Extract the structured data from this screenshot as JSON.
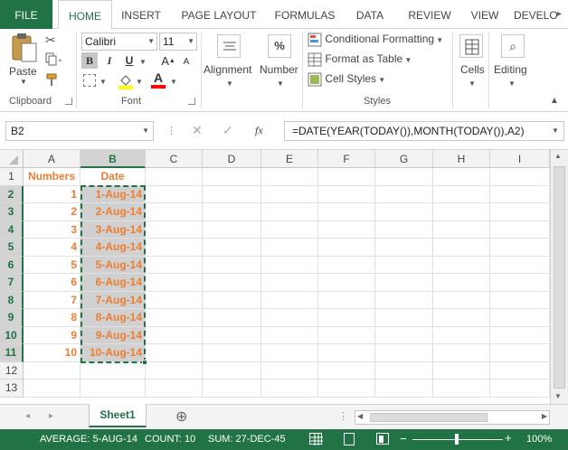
{
  "ribbon_tabs": [
    "FILE",
    "HOME",
    "INSERT",
    "PAGE LAYOUT",
    "FORMULAS",
    "DATA",
    "REVIEW",
    "VIEW",
    "DEVELO"
  ],
  "clipboard": {
    "paste_label": "Paste",
    "group_label": "Clipboard"
  },
  "font": {
    "name": "Calibri",
    "size": "11",
    "bold": "B",
    "italic": "I",
    "underline": "U",
    "grow": "A",
    "shrink": "A",
    "font_color": "A",
    "group_label": "Font"
  },
  "alignment": {
    "label": "Alignment"
  },
  "number": {
    "label": "Number",
    "symbol": "%"
  },
  "styles": {
    "conditional": "Conditional Formatting",
    "format_table": "Format as Table",
    "cell_styles": "Cell Styles",
    "group_label": "Styles"
  },
  "cells": {
    "label": "Cells"
  },
  "editing": {
    "label": "Editing"
  },
  "formula_bar": {
    "name_box": "B2",
    "fx": "fx",
    "formula": "=DATE(YEAR(TODAY()),MONTH(TODAY()),A2)"
  },
  "columns": [
    "A",
    "B",
    "C",
    "D",
    "E",
    "F",
    "G",
    "H",
    "I"
  ],
  "rows": [
    "1",
    "2",
    "3",
    "4",
    "5",
    "6",
    "7",
    "8",
    "9",
    "10",
    "11",
    "12",
    "13"
  ],
  "table": {
    "header_a": "Numbers",
    "header_b": "Date",
    "numbers": [
      "1",
      "2",
      "3",
      "4",
      "5",
      "6",
      "7",
      "8",
      "9",
      "10"
    ],
    "dates": [
      "1-Aug-14",
      "2-Aug-14",
      "3-Aug-14",
      "4-Aug-14",
      "5-Aug-14",
      "6-Aug-14",
      "7-Aug-14",
      "8-Aug-14",
      "9-Aug-14",
      "10-Aug-14"
    ]
  },
  "sheet": {
    "tab": "Sheet1",
    "add": "⊕"
  },
  "status": {
    "average": "AVERAGE: 5-AUG-14",
    "count": "COUNT: 10",
    "sum": "SUM: 27-DEC-45",
    "zoom": "100%"
  },
  "colors": {
    "accent": "#217346",
    "data_text": "#ed7d31",
    "selection_fill": "#d0d0d0"
  }
}
